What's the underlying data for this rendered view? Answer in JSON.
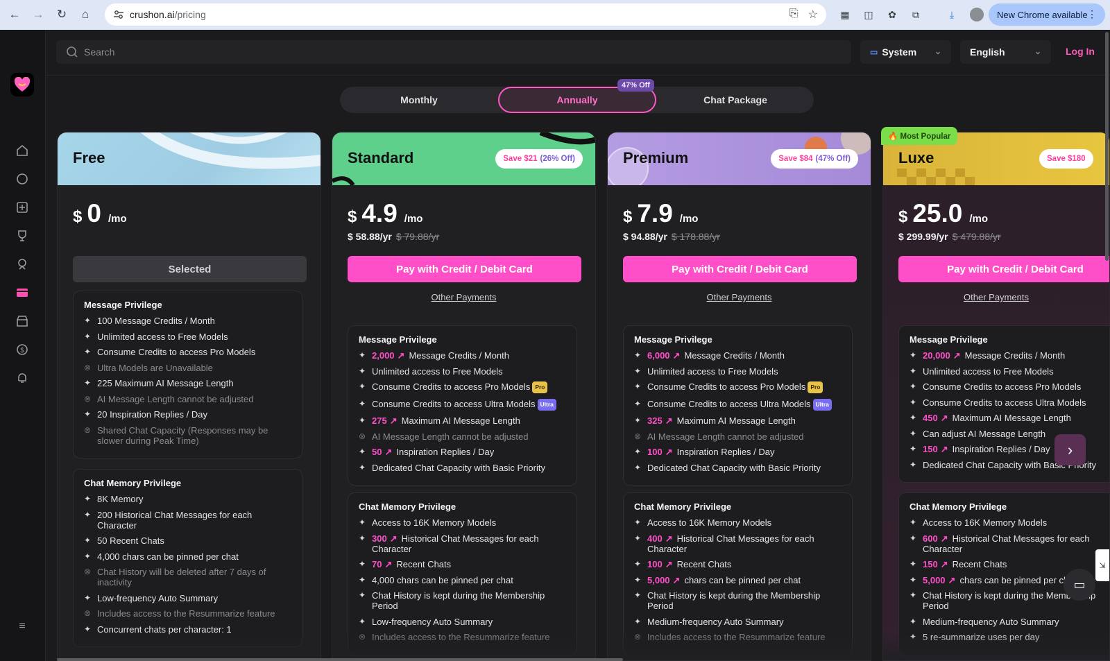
{
  "browser": {
    "url_host": "crushon.ai",
    "url_path": "/pricing",
    "new_chrome_label": "New Chrome available"
  },
  "topbar": {
    "search_placeholder": "Search",
    "theme_label": "System",
    "language_label": "English",
    "login_label": "Log In"
  },
  "billing_tabs": {
    "monthly": "Monthly",
    "annually": "Annually",
    "chat_package": "Chat Package",
    "discount_badge": "47% Off",
    "active": "annually"
  },
  "plans": [
    {
      "name": "Free",
      "currency": "$",
      "price": "0",
      "per": "/mo",
      "button": "Selected",
      "header_color": "#a7d3e6",
      "sections": [
        {
          "title": "Message Privilege",
          "items": [
            {
              "text": "100 Message Credits / Month",
              "enabled": true
            },
            {
              "text": "Unlimited access to Free Models",
              "enabled": true
            },
            {
              "text": "Consume Credits to access Pro Models",
              "enabled": true
            },
            {
              "text": "Ultra Models are Unavailable",
              "enabled": false
            },
            {
              "text": "225 Maximum AI Message Length",
              "enabled": true
            },
            {
              "text": "AI Message Length cannot be adjusted",
              "enabled": false
            },
            {
              "text": "20 Inspiration Replies / Day",
              "enabled": true
            },
            {
              "text": "Shared Chat Capacity (Responses may be slower during Peak Time)",
              "enabled": false
            }
          ]
        },
        {
          "title": "Chat Memory Privilege",
          "items": [
            {
              "text": "8K Memory",
              "enabled": true
            },
            {
              "text": "200 Historical Chat Messages for each Character",
              "enabled": true
            },
            {
              "text": "50 Recent Chats",
              "enabled": true
            },
            {
              "text": "4,000 chars can be pinned per chat",
              "enabled": true
            },
            {
              "text": "Chat History will be deleted after 7 days of inactivity",
              "enabled": false
            },
            {
              "text": "Low-frequency Auto Summary",
              "enabled": true
            },
            {
              "text": "Includes access to the Resummarize feature",
              "enabled": false
            },
            {
              "text": "Concurrent chats per character: 1",
              "enabled": true
            }
          ]
        }
      ]
    },
    {
      "name": "Standard",
      "currency": "$",
      "price": "4.9",
      "per": "/mo",
      "yearly": "$ 58.88/yr",
      "yearly_old": "$ 79.88/yr",
      "save_amount": "Save $21",
      "save_pct": "(26% Off)",
      "button": "Pay with Credit / Debit Card",
      "other_payments": "Other Payments",
      "header_color": "#5fd08c",
      "sections": [
        {
          "title": "Message Privilege",
          "items": [
            {
              "hl": "2,000",
              "text": "Message Credits / Month",
              "enabled": true
            },
            {
              "text": "Unlimited access to Free Models",
              "enabled": true
            },
            {
              "text": "Consume Credits to access Pro Models",
              "tag": "Pro",
              "enabled": true
            },
            {
              "text": "Consume Credits to access Ultra Models",
              "tag": "Ultra",
              "enabled": true
            },
            {
              "hl": "275",
              "text": "Maximum AI Message Length",
              "enabled": true
            },
            {
              "text": "AI Message Length cannot be adjusted",
              "enabled": false
            },
            {
              "hl": "50",
              "text": "Inspiration Replies / Day",
              "enabled": true
            },
            {
              "text": "Dedicated Chat Capacity with Basic Priority",
              "enabled": true
            }
          ]
        },
        {
          "title": "Chat Memory Privilege",
          "items": [
            {
              "text": "Access to 16K Memory Models",
              "enabled": true
            },
            {
              "hl": "300",
              "text": "Historical Chat Messages for each Character",
              "enabled": true
            },
            {
              "hl": "70",
              "text": "Recent Chats",
              "enabled": true
            },
            {
              "text": "4,000 chars can be pinned per chat",
              "enabled": true
            },
            {
              "text": "Chat History is kept during the Membership Period",
              "enabled": true
            },
            {
              "text": "Low-frequency Auto Summary",
              "enabled": true
            },
            {
              "text": "Includes access to the Resummarize feature",
              "enabled": false
            }
          ]
        }
      ]
    },
    {
      "name": "Premium",
      "currency": "$",
      "price": "7.9",
      "per": "/mo",
      "yearly": "$ 94.88/yr",
      "yearly_old": "$ 178.88/yr",
      "save_amount": "Save $84",
      "save_pct": "(47% Off)",
      "button": "Pay with Credit / Debit Card",
      "other_payments": "Other Payments",
      "header_color": "#b39bdf",
      "sections": [
        {
          "title": "Message Privilege",
          "items": [
            {
              "hl": "6,000",
              "text": "Message Credits / Month",
              "enabled": true
            },
            {
              "text": "Unlimited access to Free Models",
              "enabled": true
            },
            {
              "text": "Consume Credits to access Pro Models",
              "tag": "Pro",
              "enabled": true
            },
            {
              "text": "Consume Credits to access Ultra Models",
              "tag": "Ultra",
              "enabled": true
            },
            {
              "hl": "325",
              "text": "Maximum AI Message Length",
              "enabled": true
            },
            {
              "text": "AI Message Length cannot be adjusted",
              "enabled": false
            },
            {
              "hl": "100",
              "text": "Inspiration Replies / Day",
              "enabled": true
            },
            {
              "text": "Dedicated Chat Capacity with Basic Priority",
              "enabled": true
            }
          ]
        },
        {
          "title": "Chat Memory Privilege",
          "items": [
            {
              "text": "Access to 16K Memory Models",
              "enabled": true
            },
            {
              "hl": "400",
              "text": "Historical Chat Messages for each Character",
              "enabled": true
            },
            {
              "hl": "100",
              "text": "Recent Chats",
              "enabled": true
            },
            {
              "hl": "5,000",
              "text": "chars can be pinned per chat",
              "enabled": true
            },
            {
              "text": "Chat History is kept during the Membership Period",
              "enabled": true
            },
            {
              "text": "Medium-frequency Auto Summary",
              "enabled": true
            },
            {
              "text": "Includes access to the Resummarize feature",
              "enabled": false
            }
          ]
        }
      ]
    },
    {
      "name": "Luxe",
      "badge": "🔥 Most Popular",
      "currency": "$",
      "price": "25.0",
      "per": "/mo",
      "yearly": "$ 299.99/yr",
      "yearly_old": "$ 479.88/yr",
      "save_amount": "Save $180",
      "save_pct": "",
      "button": "Pay with Credit / Debit Card",
      "other_payments": "Other Payments",
      "header_color": "#e6c23c",
      "sections": [
        {
          "title": "Message Privilege",
          "items": [
            {
              "hl": "20,000",
              "text": "Message Credits / Month",
              "enabled": true
            },
            {
              "text": "Unlimited access to Free Models",
              "enabled": true
            },
            {
              "text": "Consume Credits to access Pro Models",
              "enabled": true
            },
            {
              "text": "Consume Credits to access Ultra Models",
              "enabled": true
            },
            {
              "hl": "450",
              "text": "Maximum AI Message Length",
              "enabled": true
            },
            {
              "text": "Can adjust AI Message Length",
              "enabled": true
            },
            {
              "hl": "150",
              "text": "Inspiration Replies / Day",
              "enabled": true
            },
            {
              "text": "Dedicated Chat Capacity with Basic Priority",
              "enabled": true
            }
          ]
        },
        {
          "title": "Chat Memory Privilege",
          "items": [
            {
              "text": "Access to 16K Memory Models",
              "enabled": true
            },
            {
              "hl": "600",
              "text": "Historical Chat Messages for each Character",
              "enabled": true
            },
            {
              "hl": "150",
              "text": "Recent Chats",
              "enabled": true
            },
            {
              "hl": "5,000",
              "text": "chars can be pinned per chat",
              "enabled": true
            },
            {
              "text": "Chat History is kept during the Membership Period",
              "enabled": true
            },
            {
              "text": "Medium-frequency Auto Summary",
              "enabled": true
            },
            {
              "text": "5 re-summarize uses per day",
              "enabled": true
            }
          ]
        }
      ]
    }
  ],
  "sidebar_icons": [
    "home-icon",
    "chat-icon",
    "create-icon",
    "trophy-icon",
    "character-icon",
    "pricing-icon",
    "store-icon",
    "currency-icon",
    "bell-icon",
    "menu-icon"
  ]
}
